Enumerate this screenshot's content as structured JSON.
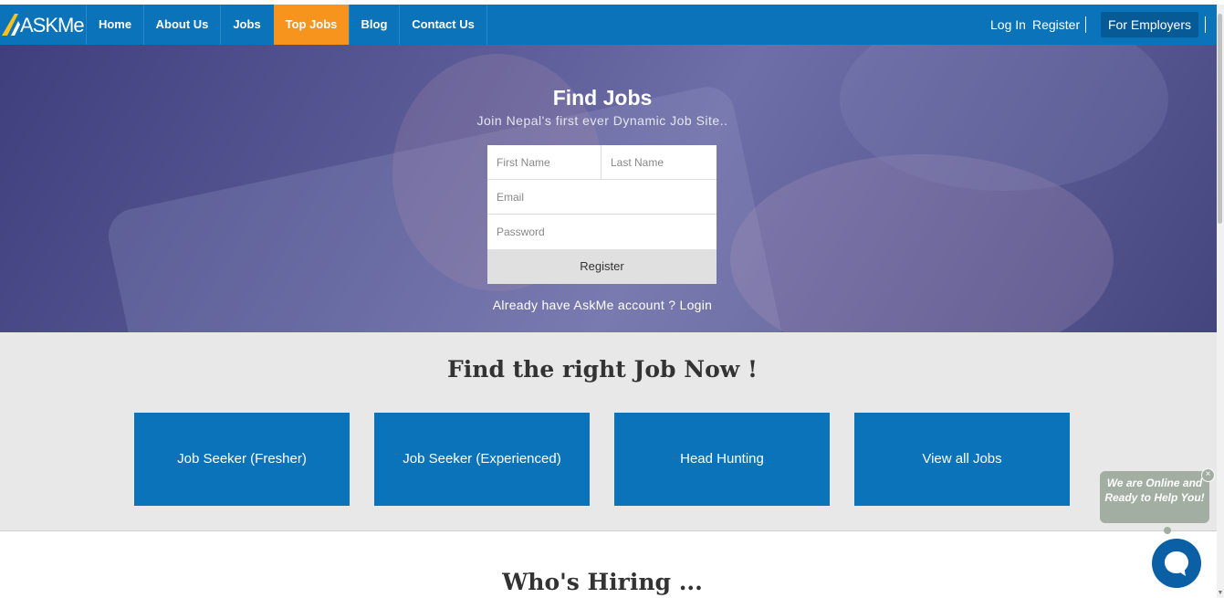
{
  "logo": {
    "text": "ASKMe"
  },
  "nav": {
    "items": [
      {
        "label": "Home"
      },
      {
        "label": "About Us"
      },
      {
        "label": "Jobs"
      },
      {
        "label": "Top Jobs"
      },
      {
        "label": "Blog"
      },
      {
        "label": "Contact Us"
      }
    ],
    "login": "Log In",
    "register": "Register",
    "employers": "For Employers"
  },
  "hero": {
    "title": "Find Jobs",
    "subtitle": "Join Nepal's first ever Dynamic Job Site..",
    "form": {
      "first_name_placeholder": "First Name",
      "last_name_placeholder": "Last Name",
      "email_placeholder": "Email",
      "password_placeholder": "Password",
      "register_label": "Register"
    },
    "already": "Already have AskMe account ? Login"
  },
  "jobs_section": {
    "title": "Find the right Job Now !",
    "categories": [
      {
        "label": "Job Seeker (Fresher)"
      },
      {
        "label": "Job Seeker (Experienced)"
      },
      {
        "label": "Head Hunting"
      },
      {
        "label": "View all Jobs"
      }
    ]
  },
  "hiring": {
    "title": "Who's Hiring ..."
  },
  "chat": {
    "message": "We are Online and Ready to Help You!",
    "close": "×"
  },
  "colors": {
    "brand_blue": "#0b73b9",
    "active_orange": "#f7941d",
    "employer_dark": "#065a96"
  }
}
